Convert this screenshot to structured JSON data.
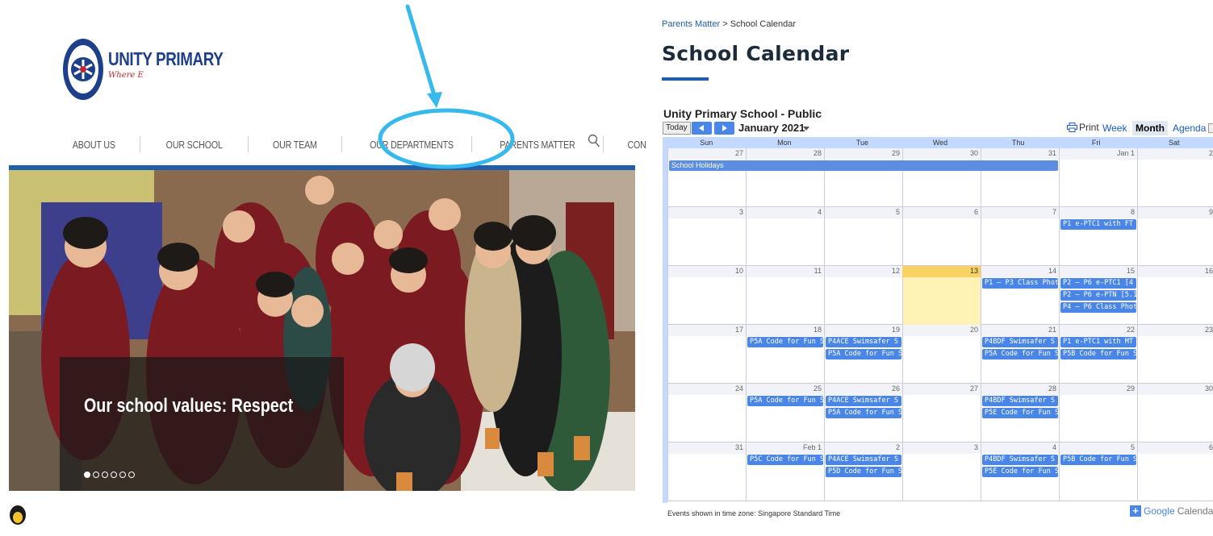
{
  "site": {
    "brand": "UNITY PRIMARY",
    "tagline": "Where E",
    "nav": [
      "ABOUT US",
      "OUR SCHOOL",
      "OUR TEAM",
      "OUR DEPARTMENTS",
      "PARENTS MATTER",
      "CONTACT"
    ],
    "hero_caption": "Our school values: Respect",
    "slide_count": 6,
    "active_slide": 1
  },
  "colors": {
    "brand_blue": "#1f5ea8",
    "highlight_cyan": "#37b9ee",
    "event_blue": "#4a86e8",
    "today_yellow": "#fff2b5"
  },
  "icons": {
    "search": "search-icon",
    "logo": "school-crest-icon",
    "print": "printer-icon"
  },
  "calendar_page": {
    "breadcrumb_link": "Parents Matter",
    "breadcrumb_sep": " > ",
    "breadcrumb_current": "School Calendar",
    "title": "School Calendar",
    "calendar_name": "Unity Primary School - Public",
    "today_label": "Today",
    "month_label": "January 2021",
    "print_label": "Print",
    "views": [
      "Week",
      "Month",
      "Agenda"
    ],
    "active_view": "Month",
    "weekdays": [
      "Sun",
      "Mon",
      "Tue",
      "Wed",
      "Thu",
      "Fri",
      "Sat"
    ],
    "weeks": [
      [
        "27",
        "28",
        "29",
        "30",
        "31",
        "Jan 1",
        "2"
      ],
      [
        "3",
        "4",
        "5",
        "6",
        "7",
        "8",
        "9"
      ],
      [
        "10",
        "11",
        "12",
        "13",
        "14",
        "15",
        "16"
      ],
      [
        "17",
        "18",
        "19",
        "20",
        "21",
        "22",
        "23"
      ],
      [
        "24",
        "25",
        "26",
        "27",
        "28",
        "29",
        "30"
      ],
      [
        "31",
        "Feb 1",
        "2",
        "3",
        "4",
        "5",
        "6"
      ]
    ],
    "today": {
      "week": 2,
      "day": 3
    },
    "events": [
      {
        "week": 0,
        "day": 0,
        "span": 5,
        "row": 0,
        "title": "School Holidays",
        "kind": "holiday"
      },
      {
        "week": 1,
        "day": 5,
        "span": 1,
        "row": 0,
        "title": "P1 e-PTC1 with FT"
      },
      {
        "week": 2,
        "day": 4,
        "span": 1,
        "row": 0,
        "title": "P1 – P3 Class Phot"
      },
      {
        "week": 2,
        "day": 5,
        "span": 1,
        "row": 0,
        "title": "P2 – P6 e-PTC1 [4"
      },
      {
        "week": 2,
        "day": 5,
        "span": 1,
        "row": 1,
        "title": "P2 – P6 e-PTN [5.1"
      },
      {
        "week": 2,
        "day": 5,
        "span": 1,
        "row": 2,
        "title": "P4 – P6 Class Phot"
      },
      {
        "week": 3,
        "day": 1,
        "span": 1,
        "row": 0,
        "title": "P5A Code for Fun S"
      },
      {
        "week": 3,
        "day": 2,
        "span": 1,
        "row": 0,
        "title": "P4ACE Swimsafer S"
      },
      {
        "week": 3,
        "day": 2,
        "span": 1,
        "row": 1,
        "title": "P5A Code for Fun S"
      },
      {
        "week": 3,
        "day": 4,
        "span": 1,
        "row": 0,
        "title": "P4BDF Swimsafer S"
      },
      {
        "week": 3,
        "day": 4,
        "span": 1,
        "row": 1,
        "title": "P5A Code for Fun S"
      },
      {
        "week": 3,
        "day": 5,
        "span": 1,
        "row": 0,
        "title": "P1 e-PTC1 with MT"
      },
      {
        "week": 3,
        "day": 5,
        "span": 1,
        "row": 1,
        "title": "P5B Code for Fun S"
      },
      {
        "week": 4,
        "day": 1,
        "span": 1,
        "row": 0,
        "title": "P5A Code for Fun S"
      },
      {
        "week": 4,
        "day": 2,
        "span": 1,
        "row": 0,
        "title": "P4ACE Swimsafer S"
      },
      {
        "week": 4,
        "day": 2,
        "span": 1,
        "row": 1,
        "title": "P5A Code for Fun S"
      },
      {
        "week": 4,
        "day": 4,
        "span": 1,
        "row": 0,
        "title": "P4BDF Swimsafer S"
      },
      {
        "week": 4,
        "day": 4,
        "span": 1,
        "row": 1,
        "title": "P5E Code for Fun S"
      },
      {
        "week": 5,
        "day": 1,
        "span": 1,
        "row": 0,
        "title": "P5C Code for Fun S"
      },
      {
        "week": 5,
        "day": 2,
        "span": 1,
        "row": 0,
        "title": "P4ACE Swimsafer S"
      },
      {
        "week": 5,
        "day": 2,
        "span": 1,
        "row": 1,
        "title": "P5D Code for Fun S"
      },
      {
        "week": 5,
        "day": 4,
        "span": 1,
        "row": 0,
        "title": "P4BDF Swimsafer S"
      },
      {
        "week": 5,
        "day": 4,
        "span": 1,
        "row": 1,
        "title": "P5E Code for Fun S"
      },
      {
        "week": 5,
        "day": 5,
        "span": 1,
        "row": 0,
        "title": "P5B Code for Fun S"
      }
    ],
    "timezone_note": "Events shown in time zone: Singapore Standard Time",
    "gcal_google": "Google",
    "gcal_calendar": "Calendar"
  }
}
